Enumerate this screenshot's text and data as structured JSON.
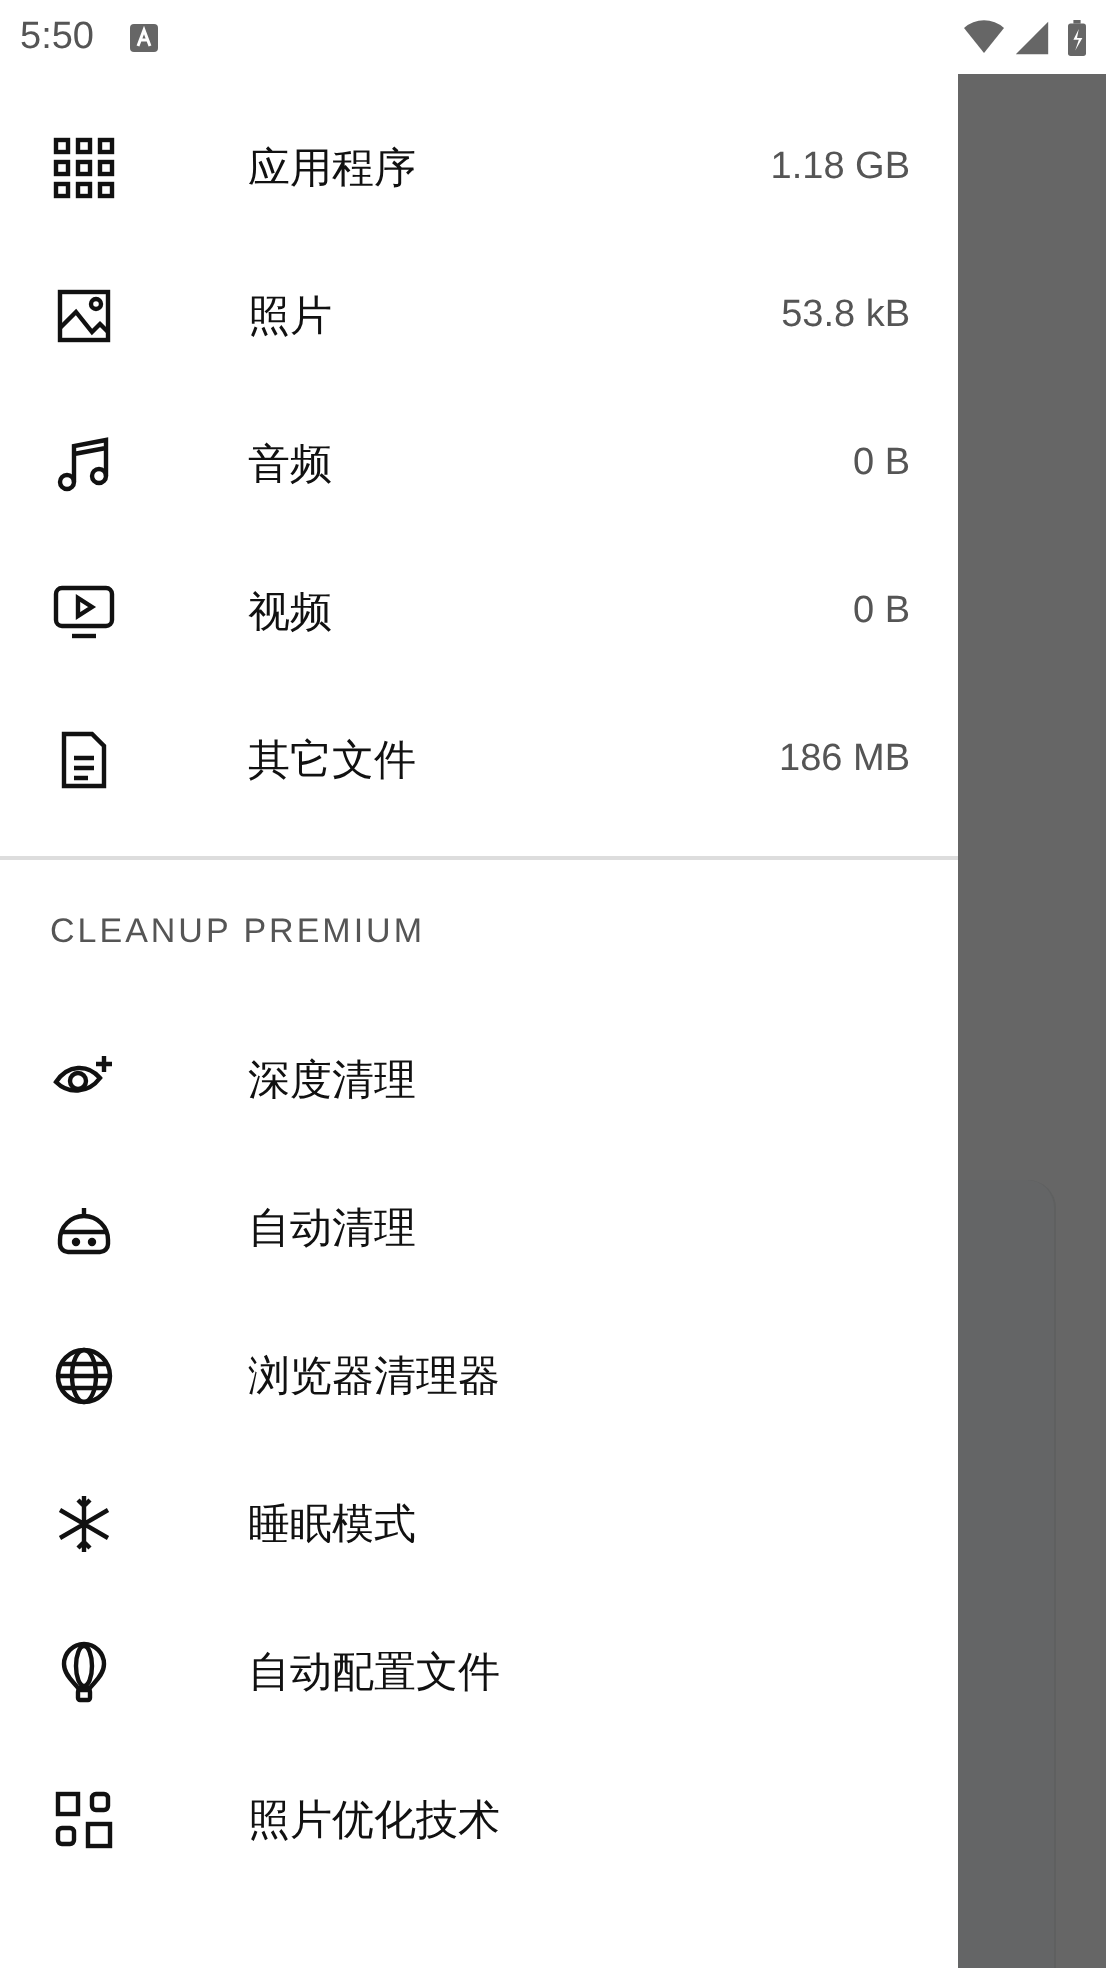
{
  "status_bar": {
    "time": "5:50"
  },
  "storage_items": [
    {
      "label": "应用程序",
      "size": "1.18 GB"
    },
    {
      "label": "照片",
      "size": "53.8 kB"
    },
    {
      "label": "音频",
      "size": "0 B"
    },
    {
      "label": "视频",
      "size": "0 B"
    },
    {
      "label": "其它文件",
      "size": "186 MB"
    }
  ],
  "premium_section": {
    "title": "CLEANUP PREMIUM",
    "items": [
      {
        "label": "深度清理"
      },
      {
        "label": "自动清理"
      },
      {
        "label": "浏览器清理器"
      },
      {
        "label": "睡眠模式"
      },
      {
        "label": "自动配置文件"
      },
      {
        "label": "照片优化技术"
      }
    ]
  }
}
